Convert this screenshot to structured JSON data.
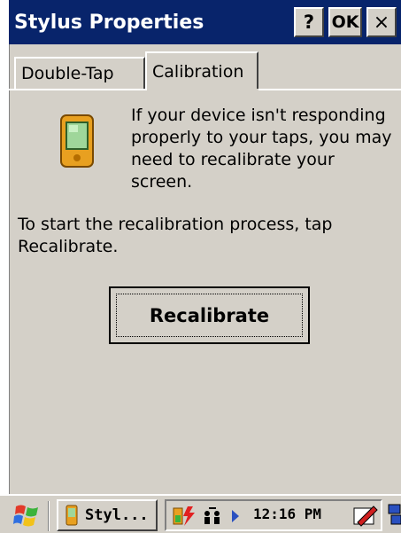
{
  "window": {
    "title": "Stylus Properties",
    "help_label": "?",
    "ok_label": "OK",
    "close_label": "×"
  },
  "tabs": [
    {
      "label": "Double-Tap",
      "selected": false
    },
    {
      "label": "Calibration",
      "selected": true
    }
  ],
  "calibration": {
    "message": "If your device isn't responding properly to your taps, you may need to recalibrate your screen.",
    "instruction": "To start the recalibration process, tap Recalibrate.",
    "button_label": "Recalibrate"
  },
  "taskbar": {
    "task_label": "Styl...",
    "clock": "12:16 PM"
  },
  "colors": {
    "titlebar": "#08246b",
    "face": "#d4d0c8"
  },
  "icons": {
    "device": "pda-device-icon",
    "start": "windows-flag-icon",
    "battery": "battery-charging-icon",
    "network": "network-icon",
    "input": "pen-input-icon",
    "desktop": "desktop-icon"
  }
}
